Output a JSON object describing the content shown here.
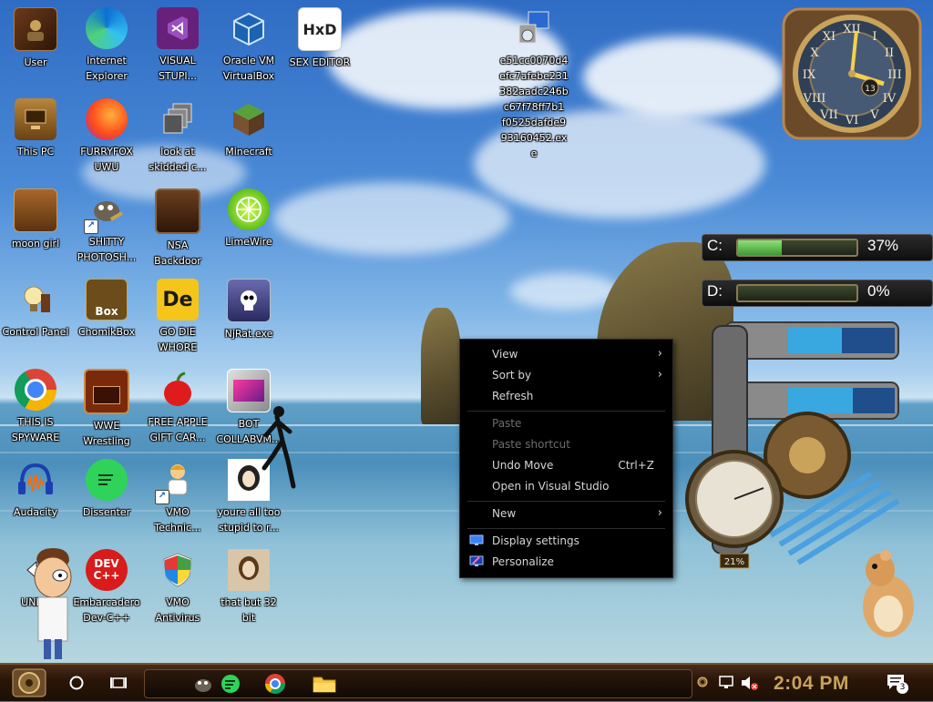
{
  "desktop": {
    "icons": [
      {
        "label": "User",
        "icon": "user-folder-icon"
      },
      {
        "label": "Internet Explorer",
        "icon": "edge-icon"
      },
      {
        "label": "VISUAL STUPI...",
        "icon": "visual-studio-icon"
      },
      {
        "label": "Oracle VM VirtualBox",
        "icon": "virtualbox-icon"
      },
      {
        "label": "SEX EDITOR",
        "icon": "hex-editor-icon"
      },
      {
        "label": "This PC",
        "icon": "computer-icon"
      },
      {
        "label": "FURRYFOX UWU",
        "icon": "firefox-icon"
      },
      {
        "label": "look at skidded c...",
        "icon": "stacked-windows-icon"
      },
      {
        "label": "Minecraft",
        "icon": "minecraft-icon"
      },
      {
        "label": "moon girl",
        "icon": "box-icon"
      },
      {
        "label": "SHITTY PHOTOSH...",
        "icon": "gimp-icon"
      },
      {
        "label": "NSA Backdoor",
        "icon": "wooden-box-icon"
      },
      {
        "label": "LimeWire",
        "icon": "limewire-icon"
      },
      {
        "label": "Control Panel",
        "icon": "lightbulb-icon"
      },
      {
        "label": "ChomikBox",
        "icon": "chomikbox-icon"
      },
      {
        "label": "GO DIE WHORE",
        "icon": "de-icon"
      },
      {
        "label": "NjRat.exe",
        "icon": "skull-icon"
      },
      {
        "label": "THIS IS SPYWARE",
        "icon": "chrome-icon"
      },
      {
        "label": "WWE Wrestling",
        "icon": "oven-icon"
      },
      {
        "label": "FREE APPLE GIFT CAR...",
        "icon": "apple-icon"
      },
      {
        "label": "BOT COLLABVM...",
        "icon": "monitor-icon"
      },
      {
        "label": "Audacity",
        "icon": "audacity-icon"
      },
      {
        "label": "Dissenter",
        "icon": "chat-bubble-icon"
      },
      {
        "label": "VMO Technic...",
        "icon": "technician-icon"
      },
      {
        "label": "youre all too stupid to r...",
        "icon": "portrait-icon"
      },
      {
        "label": "UNDE",
        "icon": "arrow-icon"
      },
      {
        "label": "Embarcadero Dev-C++",
        "icon": "devcpp-icon"
      },
      {
        "label": "VMO Antivirus",
        "icon": "shield-icon"
      },
      {
        "label": "that but 32 bit",
        "icon": "portrait-icon"
      }
    ],
    "exe_icon": {
      "label": "e51cc0070d4 efc7afebe231 382aadc246b c67f78ff7b1 f0525dafde9 93160452.ex e",
      "icon": "installer-icon"
    }
  },
  "context_menu": {
    "items": [
      {
        "label": "View",
        "submenu": true
      },
      {
        "label": "Sort by",
        "submenu": true
      },
      {
        "label": "Refresh"
      },
      {
        "label": "Paste",
        "disabled": true
      },
      {
        "label": "Paste shortcut",
        "disabled": true
      },
      {
        "label": "Undo Move",
        "shortcut": "Ctrl+Z"
      },
      {
        "label": "Open in Visual Studio"
      },
      {
        "label": "New",
        "submenu": true
      },
      {
        "label": "Display settings",
        "icon": "display-icon"
      },
      {
        "label": "Personalize",
        "icon": "personalize-icon"
      }
    ],
    "arrow": "›"
  },
  "widgets": {
    "clock_number": "13",
    "drives": [
      {
        "letter": "C:",
        "percent": "37%",
        "fill": 0.37
      },
      {
        "letter": "D:",
        "percent": "0%",
        "fill": 0.0
      }
    ],
    "gauge_label": "21%"
  },
  "taskbar": {
    "time": "2:04 PM",
    "notification_count": "3"
  },
  "colors": {
    "menu_bg": "#000000",
    "taskbar_time": "#c9a35a",
    "gauge_green": "#5fc04a"
  }
}
